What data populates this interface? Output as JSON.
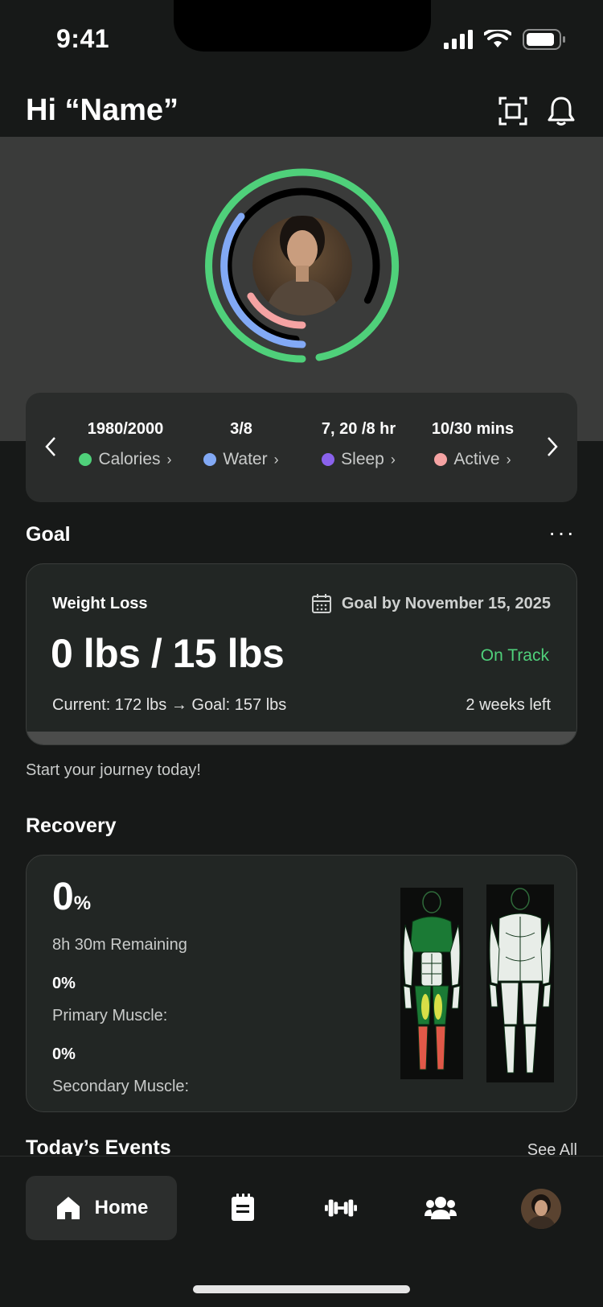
{
  "status_bar": {
    "time": "9:41"
  },
  "header": {
    "greeting": "Hi “Name”",
    "scan_icon": "scan-icon",
    "bell_icon": "bell-icon"
  },
  "stats": [
    {
      "value": "1980/2000",
      "label": "Calories",
      "color": "#4fd07a"
    },
    {
      "value": "3/8",
      "label": "Water",
      "color": "#82a9f5"
    },
    {
      "value": "7, 20 /8 hr",
      "label": "Sleep",
      "color": "#8a62ec"
    },
    {
      "value": "10/30 mins",
      "label": "Active",
      "color": "#f5a3a3"
    }
  ],
  "goal": {
    "section_title": "Goal",
    "type": "Weight Loss",
    "date": "Goal by November 15, 2025",
    "amount": "0 lbs / 15 lbs",
    "status": "On Track",
    "current": "Current: 172 lbs → Goal: 157 lbs",
    "time_left": "2 weeks left",
    "progress": 0,
    "journey_text": "Start your journey today!"
  },
  "recovery": {
    "section_title": "Recovery",
    "percent": "0",
    "percent_sign": "%",
    "remaining": "8h 30m Remaining",
    "primary_value": "0%",
    "primary_label": "Primary Muscle:",
    "secondary_value": "0%",
    "secondary_label": "Secondary Muscle:"
  },
  "events": {
    "title": "Today’s Events",
    "see_all": "See All"
  },
  "nav": {
    "home_label": "Home"
  },
  "colors": {
    "accent_green": "#4fd07a",
    "water_blue": "#82a9f5",
    "sleep_purple": "#8a62ec",
    "active_pink": "#f5a3a3"
  }
}
